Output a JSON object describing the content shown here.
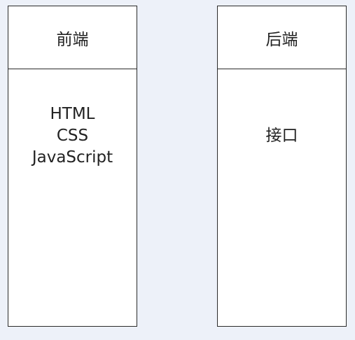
{
  "diagram": {
    "boxes": [
      {
        "title": "前端",
        "items": [
          "HTML",
          "CSS",
          "JavaScript"
        ]
      },
      {
        "title": "后端",
        "items": [
          "接口"
        ]
      }
    ]
  },
  "colors": {
    "background": "#edf1f9",
    "box_fill": "#ffffff",
    "border": "#2a2a2a",
    "text": "#222222"
  }
}
